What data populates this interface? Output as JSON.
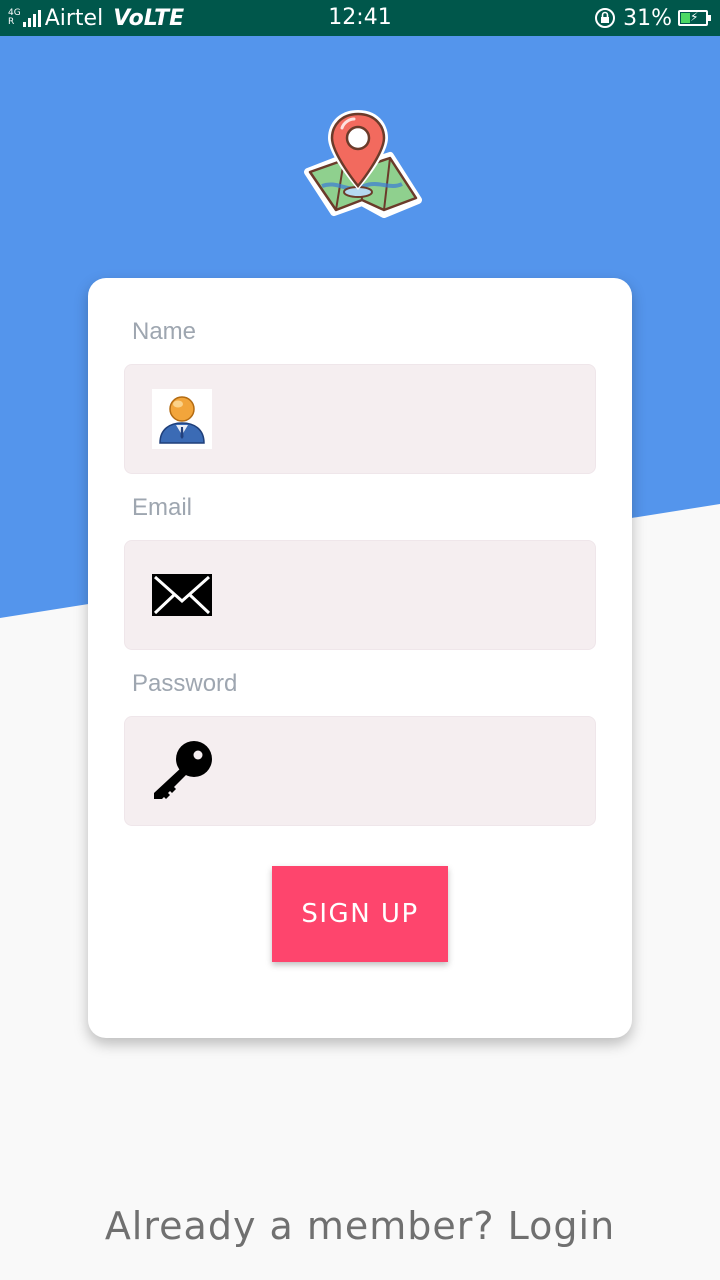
{
  "status_bar": {
    "network_type": "4G",
    "roaming": "R",
    "carrier": "Airtel",
    "volte": "VoLTE",
    "time": "12:41",
    "battery_percent": "31%",
    "battery_level": 0.31
  },
  "form": {
    "name_label": "Name",
    "name_value": "",
    "name_icon": "user-icon",
    "email_label": "Email",
    "email_value": "",
    "email_icon": "envelope-icon",
    "password_label": "Password",
    "password_value": "",
    "password_icon": "key-icon",
    "submit_label": "SIGN UP"
  },
  "footer": {
    "login_text": "Already a member? Login"
  },
  "colors": {
    "status_bar": "#00574b",
    "header_blue": "#5495ec",
    "button": "#fe456d",
    "field_bg": "#f5eef0"
  },
  "logo_icon": "map-pin-icon"
}
